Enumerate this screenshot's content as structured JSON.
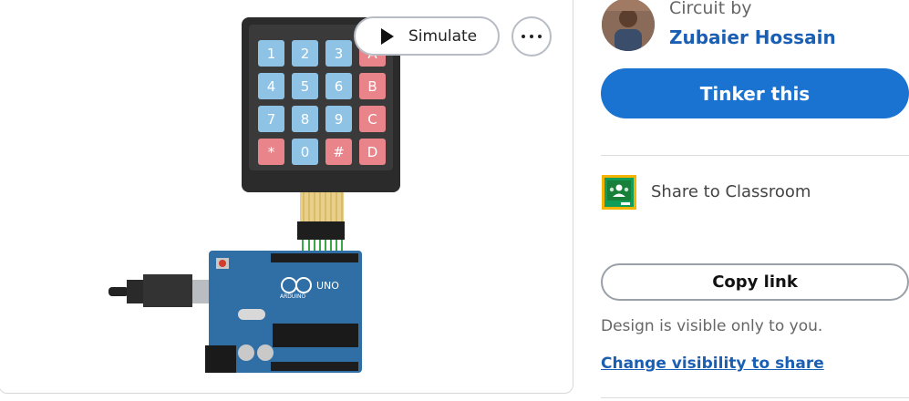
{
  "preview": {
    "simulate_label": "Simulate",
    "keypad_keys": [
      "1",
      "2",
      "3",
      "A",
      "4",
      "5",
      "6",
      "B",
      "7",
      "8",
      "9",
      "C",
      "*",
      "0",
      "#",
      "D"
    ],
    "board_label": "UNO",
    "board_brand": "ARDUINO"
  },
  "author": {
    "circuit_by_label": "Circuit by",
    "name": "Zubaier Hossain"
  },
  "actions": {
    "tinker_label": "Tinker this",
    "share_classroom_label": "Share to Classroom",
    "copy_link_label": "Copy link",
    "visibility_note": "Design is visible only to you.",
    "visibility_link": "Change visibility to share"
  },
  "colors": {
    "primary": "#1a73d1",
    "link": "#1a5fb4",
    "keypad_blue": "#8fc3e6",
    "keypad_red": "#e8848a",
    "board_blue": "#2f6fa6"
  }
}
